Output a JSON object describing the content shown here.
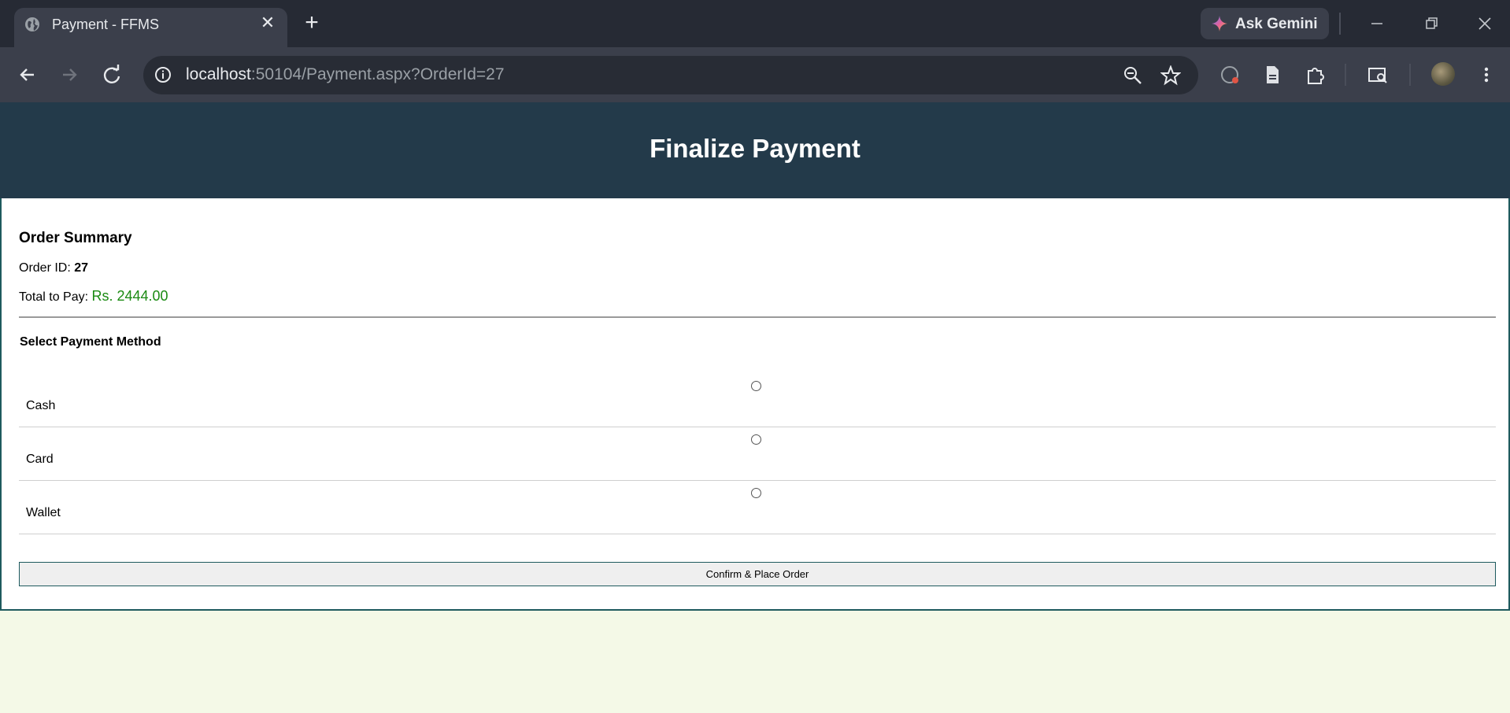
{
  "browser": {
    "tab": {
      "title": "Payment - FFMS"
    },
    "gemini_label": "Ask Gemini",
    "url": {
      "host": "localhost",
      "rest": ":50104/Payment.aspx?OrderId=27"
    }
  },
  "icons": {
    "tab_favicon": "globe-icon",
    "back": "back-arrow-icon",
    "forward": "forward-arrow-icon",
    "reload": "reload-icon",
    "site_info": "info-icon",
    "zoom": "zoom-out-icon",
    "bookmark": "star-icon",
    "extensions": "puzzle-icon"
  },
  "page": {
    "title": "Finalize Payment",
    "summary": {
      "heading": "Order Summary",
      "order_id_label": "Order ID: ",
      "order_id": "27",
      "total_label": "Total to Pay: ",
      "total_amount": "Rs. 2444.00"
    },
    "payment": {
      "heading": "Select Payment Method",
      "methods": [
        {
          "label": "Cash",
          "selected": false
        },
        {
          "label": "Card",
          "selected": false
        },
        {
          "label": "Wallet",
          "selected": false
        }
      ]
    },
    "confirm_label": "Confirm & Place Order"
  },
  "colors": {
    "header_bg": "#233a4a",
    "page_bg": "#f4f9e7",
    "card_border": "#1e5a5e",
    "amount": "#1a8a12"
  }
}
